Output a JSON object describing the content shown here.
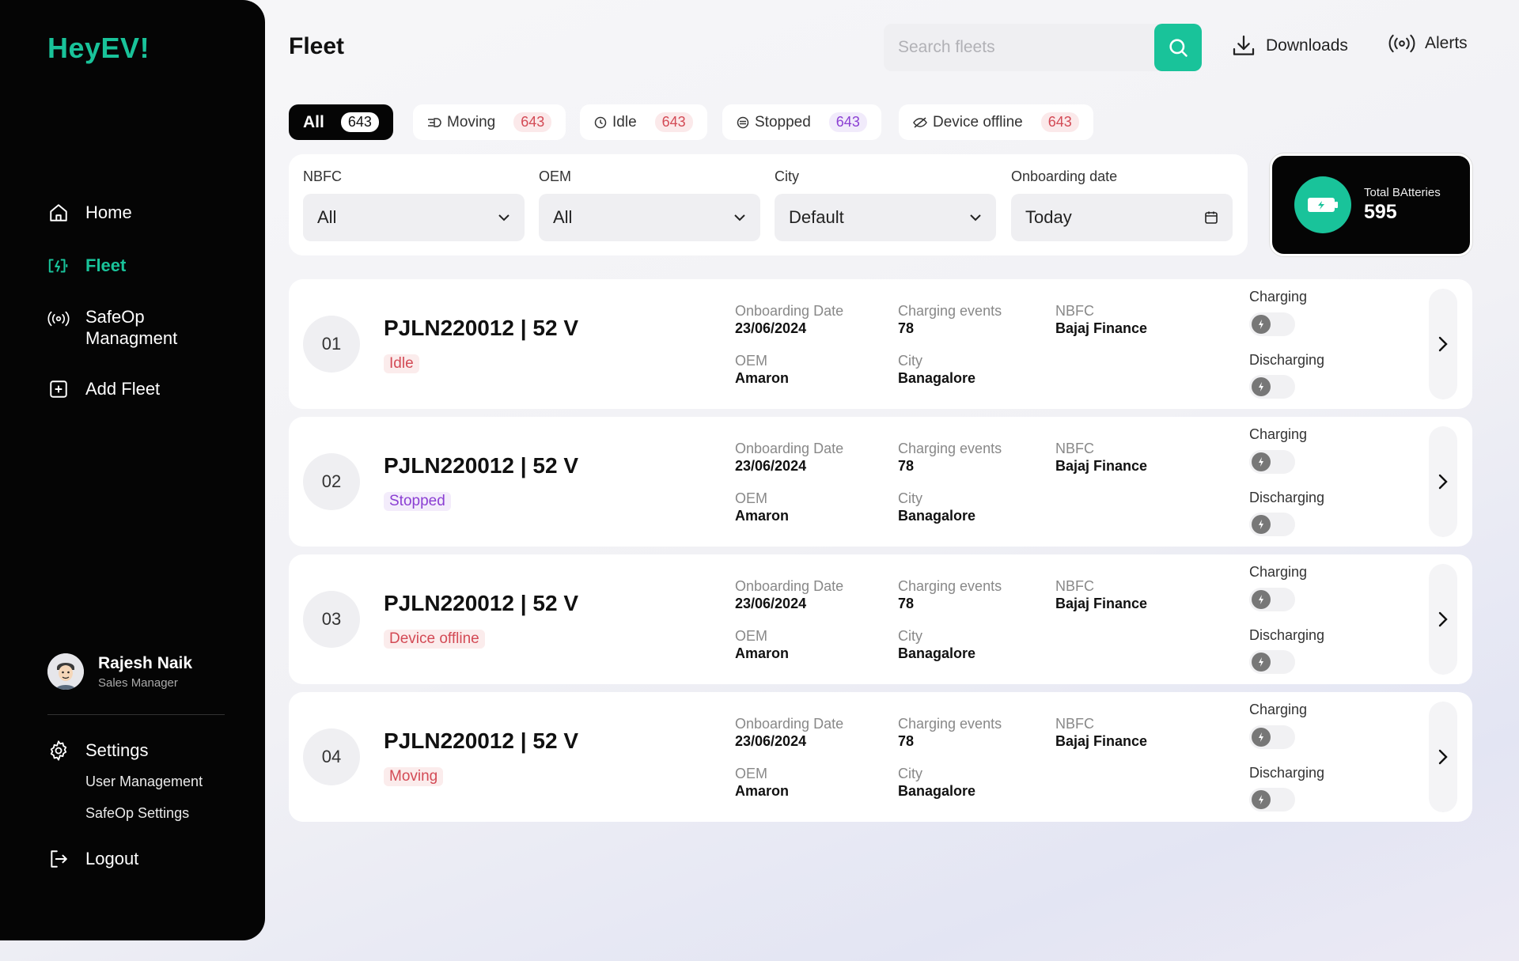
{
  "app": {
    "logo": "HeyEV!"
  },
  "sidebar": {
    "items": [
      {
        "label": "Home",
        "icon": "home-icon"
      },
      {
        "label": "Fleet",
        "icon": "battery-charging-icon",
        "active": true
      },
      {
        "label": "SafeOp Managment",
        "icon": "broadcast-icon"
      },
      {
        "label": "Add Fleet",
        "icon": "plus-square-icon"
      }
    ],
    "user": {
      "name": "Rajesh Naik",
      "role": "Sales Manager"
    },
    "settings": {
      "label": "Settings",
      "sub": [
        "User Management",
        "SafeOp Settings"
      ]
    },
    "logout": "Logout"
  },
  "header": {
    "title": "Fleet",
    "search_placeholder": "Search fleets",
    "downloads": "Downloads",
    "alerts": "Alerts"
  },
  "tabs": [
    {
      "label": "All",
      "count": "643",
      "active": true
    },
    {
      "label": "Moving",
      "count": "643",
      "icon": "moving-icon"
    },
    {
      "label": "Idle",
      "count": "643",
      "icon": "clock-icon"
    },
    {
      "label": "Stopped",
      "count": "643",
      "icon": "stopped-icon",
      "badge_color": "purple"
    },
    {
      "label": "Device offline",
      "count": "643",
      "icon": "eye-off-icon"
    }
  ],
  "filters": [
    {
      "label": "NBFC",
      "value": "All"
    },
    {
      "label": "OEM",
      "value": "All"
    },
    {
      "label": "City",
      "value": "Default"
    },
    {
      "label": "Onboarding date",
      "value": "Today"
    }
  ],
  "total_batteries": {
    "label": "Total BAtteries",
    "value": "595"
  },
  "field_labels": {
    "onboarding": "Onboarding Date",
    "charging_events": "Charging events",
    "nbfc": "NBFC",
    "oem": "OEM",
    "city": "City",
    "charging": "Charging",
    "discharging": "Discharging"
  },
  "rows": [
    {
      "num": "01",
      "id": "PJLN220012 | 52 V",
      "status": "Idle",
      "status_key": "idle",
      "onboarding": "23/06/2024",
      "charging_events": "78",
      "nbfc": "Bajaj Finance",
      "oem": "Amaron",
      "city": "Banagalore"
    },
    {
      "num": "02",
      "id": "PJLN220012 | 52 V",
      "status": "Stopped",
      "status_key": "stopped",
      "onboarding": "23/06/2024",
      "charging_events": "78",
      "nbfc": "Bajaj Finance",
      "oem": "Amaron",
      "city": "Banagalore"
    },
    {
      "num": "03",
      "id": "PJLN220012 | 52 V",
      "status": "Device offline",
      "status_key": "offline",
      "onboarding": "23/06/2024",
      "charging_events": "78",
      "nbfc": "Bajaj Finance",
      "oem": "Amaron",
      "city": "Banagalore"
    },
    {
      "num": "04",
      "id": "PJLN220012 | 52 V",
      "status": "Moving",
      "status_key": "moving",
      "onboarding": "23/06/2024",
      "charging_events": "78",
      "nbfc": "Bajaj Finance",
      "oem": "Amaron",
      "city": "Banagalore"
    }
  ],
  "colors": {
    "accent": "#19c39a",
    "sidebar": "#050505",
    "danger": "#d34a55",
    "purple": "#8b3fd3"
  }
}
